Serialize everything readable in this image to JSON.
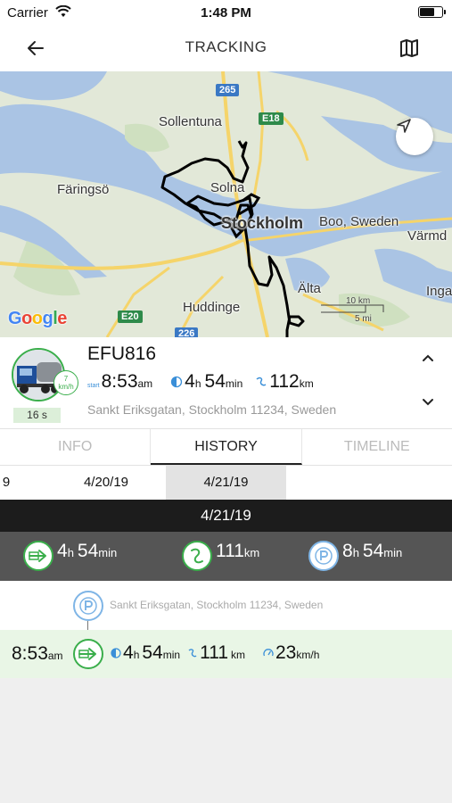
{
  "status_bar": {
    "carrier": "Carrier",
    "time": "1:48 PM"
  },
  "nav": {
    "title": "TRACKING",
    "back_icon": "arrow-left-icon",
    "map_icon": "map-icon"
  },
  "map": {
    "labels": {
      "sollentuna": "Sollentuna",
      "faringso": "Färingsö",
      "solna": "Solna",
      "stockholm": "Stockholm",
      "boo": "Boo, Sweden",
      "varmdo": "Värmd",
      "alta": "Älta",
      "huddinge": "Huddinge",
      "inga": "Inga"
    },
    "shields": {
      "r265": "265",
      "e18": "E18",
      "e20": "E20",
      "r226": "226"
    },
    "scale": {
      "km": "10 km",
      "mi": "5 mi"
    },
    "attribution": "Google",
    "colors": {
      "water": "#aac4e4",
      "land": "#e2e8d8",
      "road": "#f5d46a",
      "route": "#000000"
    }
  },
  "vehicle": {
    "plate": "EFU816",
    "speed_value": "7",
    "speed_unit": "km/h",
    "age": "16 s",
    "start_label": "start",
    "start_time": "8:53",
    "start_ampm": "am",
    "duration_h": "4",
    "duration_h_unit": "h",
    "duration_m": "54",
    "duration_m_unit": "min",
    "distance": "112",
    "distance_unit": "km",
    "address": "Sankt Eriksgatan, Stockholm 11234, Sweden"
  },
  "tabs": [
    {
      "label": "INFO",
      "active": false
    },
    {
      "label": "HISTORY",
      "active": true
    },
    {
      "label": "TIMELINE",
      "active": false
    }
  ],
  "dates": {
    "prev_partial": "9",
    "d1": "4/20/19",
    "d2": "4/21/19"
  },
  "day": {
    "title": "4/21/19",
    "summary": {
      "drive_h": "4",
      "drive_h_unit": "h",
      "drive_m": "54",
      "drive_m_unit": "min",
      "distance": "111",
      "distance_unit": "km",
      "park_h": "8",
      "park_h_unit": "h",
      "park_m": "54",
      "park_m_unit": "min"
    }
  },
  "timeline": {
    "parking_address": "Sankt Eriksgatan, Stockholm 11234, Sweden",
    "trip": {
      "start_time": "8:53",
      "start_ampm": "am",
      "duration_h": "4",
      "duration_h_unit": "h",
      "duration_m": "54",
      "duration_m_unit": "min",
      "distance": "111",
      "distance_unit": "km",
      "avg_speed": "23",
      "avg_speed_unit": "km/h"
    }
  }
}
